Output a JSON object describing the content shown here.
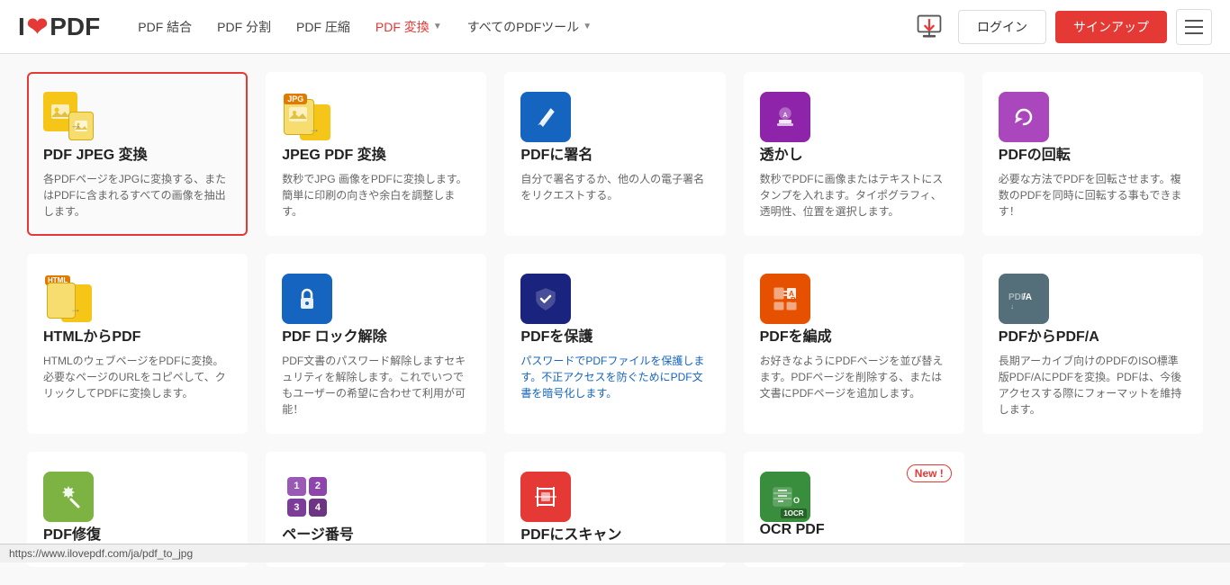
{
  "header": {
    "logo": "I❤PDF",
    "nav": [
      {
        "label": "PDF 結合",
        "dropdown": false
      },
      {
        "label": "PDF 分割",
        "dropdown": false
      },
      {
        "label": "PDF 圧縮",
        "dropdown": false
      },
      {
        "label": "PDF 変換",
        "dropdown": true
      },
      {
        "label": "すべてのPDFツール",
        "dropdown": true
      }
    ],
    "login_label": "ログイン",
    "signup_label": "サインアップ"
  },
  "tools": [
    {
      "id": "pdf-jpeg",
      "title": "PDF JPEG 変換",
      "desc": "各PDFページをJPGに変換する、またはPDFに含まれるすべての画像を抽出します。",
      "selected": true,
      "new": false,
      "desc_style": "normal"
    },
    {
      "id": "jpeg-pdf",
      "title": "JPEG PDF 変換",
      "desc": "数秒でJPG 画像をPDFに変換します。簡単に印刷の向きや余白を調整します。",
      "selected": false,
      "new": false,
      "desc_style": "normal"
    },
    {
      "id": "pdf-sign",
      "title": "PDFに署名",
      "desc": "自分で署名するか、他の人の電子署名をリクエストする。",
      "selected": false,
      "new": false,
      "desc_style": "normal"
    },
    {
      "id": "watermark",
      "title": "透かし",
      "desc": "数秒でPDFに画像またはテキストにスタンプを入れます。タイポグラフィ、透明性、位置を選択します。",
      "selected": false,
      "new": false,
      "desc_style": "normal"
    },
    {
      "id": "rotate",
      "title": "PDFの回転",
      "desc": "必要な方法でPDFを回転させます。複数のPDFを同時に回転する事もできます！",
      "selected": false,
      "new": false,
      "desc_style": "normal"
    },
    {
      "id": "html-pdf",
      "title": "HTMLからPDF",
      "desc": "HTMLのウェブページをPDFに変換。必要なページのURLをコピペして、クリックしてPDFに変換します。",
      "selected": false,
      "new": false,
      "desc_style": "link"
    },
    {
      "id": "unlock",
      "title": "PDF ロック解除",
      "desc": "PDF文書のパスワード解除しますセキュリティを解除します。これでいつでもユーザーの希望に合わせて利用が可能！",
      "selected": false,
      "new": false,
      "desc_style": "normal"
    },
    {
      "id": "protect",
      "title": "PDFを保護",
      "desc": "パスワードでPDFファイルを保護します。不正アクセスを防ぐためにPDF文書を暗号化します。",
      "selected": false,
      "new": false,
      "desc_style": "link"
    },
    {
      "id": "edit",
      "title": "PDFを編成",
      "desc": "お好きなようにPDFページを並び替えます。PDFページを削除する、または文書にPDFページを追加します。",
      "selected": false,
      "new": false,
      "desc_style": "normal"
    },
    {
      "id": "pdfa",
      "title": "PDFからPDF/A",
      "desc": "長期アーカイブ向けのPDFのISO標準版PDF/AにPDFを変換。PDFは、今後アクセスする際にフォーマットを維持します。",
      "selected": false,
      "new": false,
      "desc_style": "normal"
    },
    {
      "id": "repair",
      "title": "PDF修復",
      "desc": "",
      "selected": false,
      "new": false,
      "desc_style": "normal"
    },
    {
      "id": "page-num",
      "title": "ページ番号",
      "desc": "",
      "selected": false,
      "new": false,
      "desc_style": "normal"
    },
    {
      "id": "scan",
      "title": "PDFにスキャン",
      "desc": "",
      "selected": false,
      "new": false,
      "desc_style": "normal"
    },
    {
      "id": "ocr",
      "title": "OCR PDF",
      "desc": "",
      "selected": false,
      "new": true,
      "desc_style": "normal"
    }
  ],
  "statusbar": {
    "url": "https://www.ilovepdf.com/ja/pdf_to_jpg"
  },
  "new_badge_label": "New !"
}
